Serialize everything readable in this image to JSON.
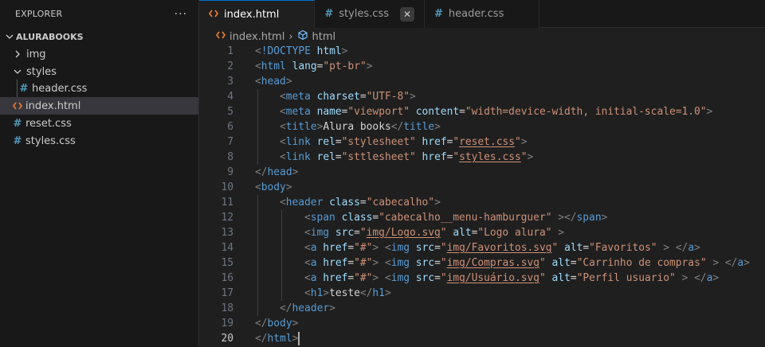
{
  "explorer": {
    "title": "EXPLORER",
    "more": "···",
    "root": "ALURABOOKS",
    "items": [
      {
        "label": "img",
        "type": "folder-collapsed",
        "depth": 1
      },
      {
        "label": "styles",
        "type": "folder-expanded",
        "depth": 1
      },
      {
        "label": "header.css",
        "type": "css",
        "depth": 2
      },
      {
        "label": "index.html",
        "type": "html",
        "depth": 1,
        "selected": true
      },
      {
        "label": "reset.css",
        "type": "css",
        "depth": 1
      },
      {
        "label": "styles.css",
        "type": "css",
        "depth": 1
      }
    ]
  },
  "tabs": [
    {
      "label": "index.html",
      "icon": "html-icon",
      "active": true
    },
    {
      "label": "styles.css",
      "icon": "css-icon",
      "active": false
    },
    {
      "label": "header.css",
      "icon": "css-icon",
      "active": false
    }
  ],
  "breadcrumb": {
    "file": "index.html",
    "separator": "›",
    "node": "html"
  },
  "code": {
    "current_line": 20,
    "lines": [
      {
        "n": 1,
        "indent": 0,
        "tokens": [
          [
            "t-punc",
            "<"
          ],
          [
            "t-tag",
            "!DOCTYPE"
          ],
          [
            "t-text",
            " "
          ],
          [
            "t-attr",
            "html"
          ],
          [
            "t-punc",
            ">"
          ]
        ]
      },
      {
        "n": 2,
        "indent": 0,
        "tokens": [
          [
            "t-punc",
            "<"
          ],
          [
            "t-tag",
            "html"
          ],
          [
            "t-text",
            " "
          ],
          [
            "t-attr",
            "lang"
          ],
          [
            "t-text",
            "="
          ],
          [
            "t-str",
            "\"pt-br\""
          ],
          [
            "t-punc",
            ">"
          ]
        ]
      },
      {
        "n": 3,
        "indent": 0,
        "tokens": [
          [
            "t-punc",
            "<"
          ],
          [
            "t-tag",
            "head"
          ],
          [
            "t-punc",
            ">"
          ]
        ]
      },
      {
        "n": 4,
        "indent": 1,
        "tokens": [
          [
            "t-punc",
            "<"
          ],
          [
            "t-tag",
            "meta"
          ],
          [
            "t-text",
            " "
          ],
          [
            "t-attr",
            "charset"
          ],
          [
            "t-text",
            "="
          ],
          [
            "t-str",
            "\"UTF-8\""
          ],
          [
            "t-punc",
            ">"
          ]
        ]
      },
      {
        "n": 5,
        "indent": 1,
        "tokens": [
          [
            "t-punc",
            "<"
          ],
          [
            "t-tag",
            "meta"
          ],
          [
            "t-text",
            " "
          ],
          [
            "t-attr",
            "name"
          ],
          [
            "t-text",
            "="
          ],
          [
            "t-str",
            "\"viewport\""
          ],
          [
            "t-text",
            " "
          ],
          [
            "t-attr",
            "content"
          ],
          [
            "t-text",
            "="
          ],
          [
            "t-str",
            "\"width=device-width, initial-scale=1.0\""
          ],
          [
            "t-punc",
            ">"
          ]
        ]
      },
      {
        "n": 6,
        "indent": 1,
        "tokens": [
          [
            "t-punc",
            "<"
          ],
          [
            "t-tag",
            "title"
          ],
          [
            "t-punc",
            ">"
          ],
          [
            "t-text",
            "Alura books"
          ],
          [
            "t-punc",
            "</"
          ],
          [
            "t-tag",
            "title"
          ],
          [
            "t-punc",
            ">"
          ]
        ]
      },
      {
        "n": 7,
        "indent": 1,
        "tokens": [
          [
            "t-punc",
            "<"
          ],
          [
            "t-tag",
            "link"
          ],
          [
            "t-text",
            " "
          ],
          [
            "t-attr",
            "rel"
          ],
          [
            "t-text",
            "="
          ],
          [
            "t-str",
            "\"stylesheet\""
          ],
          [
            "t-text",
            " "
          ],
          [
            "t-attr",
            "href"
          ],
          [
            "t-text",
            "="
          ],
          [
            "t-str",
            "\""
          ],
          [
            "t-str t-link",
            "reset.css"
          ],
          [
            "t-str",
            "\""
          ],
          [
            "t-punc",
            ">"
          ]
        ]
      },
      {
        "n": 8,
        "indent": 1,
        "tokens": [
          [
            "t-punc",
            "<"
          ],
          [
            "t-tag",
            "link"
          ],
          [
            "t-text",
            " "
          ],
          [
            "t-attr",
            "rel"
          ],
          [
            "t-text",
            "="
          ],
          [
            "t-str",
            "\"sttlesheet\""
          ],
          [
            "t-text",
            " "
          ],
          [
            "t-attr",
            "href"
          ],
          [
            "t-text",
            "="
          ],
          [
            "t-str",
            "\""
          ],
          [
            "t-str t-link",
            "styles.css"
          ],
          [
            "t-str",
            "\""
          ],
          [
            "t-punc",
            ">"
          ]
        ]
      },
      {
        "n": 9,
        "indent": 0,
        "tokens": [
          [
            "t-punc",
            "</"
          ],
          [
            "t-tag",
            "head"
          ],
          [
            "t-punc",
            ">"
          ]
        ]
      },
      {
        "n": 10,
        "indent": 0,
        "tokens": [
          [
            "t-punc",
            "<"
          ],
          [
            "t-tag",
            "body"
          ],
          [
            "t-punc",
            ">"
          ]
        ]
      },
      {
        "n": 11,
        "indent": 1,
        "tokens": [
          [
            "t-punc",
            "<"
          ],
          [
            "t-tag",
            "header"
          ],
          [
            "t-text",
            " "
          ],
          [
            "t-attr",
            "class"
          ],
          [
            "t-text",
            "="
          ],
          [
            "t-str",
            "\"cabecalho\""
          ],
          [
            "t-punc",
            ">"
          ]
        ]
      },
      {
        "n": 12,
        "indent": 2,
        "tokens": [
          [
            "t-punc",
            "<"
          ],
          [
            "t-tag",
            "span"
          ],
          [
            "t-text",
            " "
          ],
          [
            "t-attr",
            "class"
          ],
          [
            "t-text",
            "="
          ],
          [
            "t-str",
            "\"cabecalho__menu-hamburguer\""
          ],
          [
            "t-text",
            " "
          ],
          [
            "t-punc",
            "></"
          ],
          [
            "t-tag",
            "span"
          ],
          [
            "t-punc",
            ">"
          ]
        ]
      },
      {
        "n": 13,
        "indent": 2,
        "tokens": [
          [
            "t-punc",
            "<"
          ],
          [
            "t-tag",
            "img"
          ],
          [
            "t-text",
            " "
          ],
          [
            "t-attr",
            "src"
          ],
          [
            "t-text",
            "="
          ],
          [
            "t-str",
            "\""
          ],
          [
            "t-str t-link",
            "img/Logo.svg"
          ],
          [
            "t-str",
            "\""
          ],
          [
            "t-text",
            " "
          ],
          [
            "t-attr",
            "alt"
          ],
          [
            "t-text",
            "="
          ],
          [
            "t-str",
            "\"Logo alura\""
          ],
          [
            "t-text",
            " "
          ],
          [
            "t-punc",
            ">"
          ]
        ]
      },
      {
        "n": 14,
        "indent": 2,
        "tokens": [
          [
            "t-punc",
            "<"
          ],
          [
            "t-tag",
            "a"
          ],
          [
            "t-text",
            " "
          ],
          [
            "t-attr",
            "href"
          ],
          [
            "t-text",
            "="
          ],
          [
            "t-str",
            "\"#\""
          ],
          [
            "t-punc",
            ">"
          ],
          [
            "t-text",
            " "
          ],
          [
            "t-punc",
            "<"
          ],
          [
            "t-tag",
            "img"
          ],
          [
            "t-text",
            " "
          ],
          [
            "t-attr",
            "src"
          ],
          [
            "t-text",
            "="
          ],
          [
            "t-str",
            "\""
          ],
          [
            "t-str t-link",
            "img/Favoritos.svg"
          ],
          [
            "t-str",
            "\""
          ],
          [
            "t-text",
            " "
          ],
          [
            "t-attr",
            "alt"
          ],
          [
            "t-text",
            "="
          ],
          [
            "t-str",
            "\"Favoritos\""
          ],
          [
            "t-text",
            " "
          ],
          [
            "t-punc",
            "> </"
          ],
          [
            "t-tag",
            "a"
          ],
          [
            "t-punc",
            ">"
          ]
        ]
      },
      {
        "n": 15,
        "indent": 2,
        "tokens": [
          [
            "t-punc",
            "<"
          ],
          [
            "t-tag",
            "a"
          ],
          [
            "t-text",
            " "
          ],
          [
            "t-attr",
            "href"
          ],
          [
            "t-text",
            "="
          ],
          [
            "t-str",
            "\"#\""
          ],
          [
            "t-punc",
            ">"
          ],
          [
            "t-text",
            " "
          ],
          [
            "t-punc",
            "<"
          ],
          [
            "t-tag",
            "img"
          ],
          [
            "t-text",
            " "
          ],
          [
            "t-attr",
            "src"
          ],
          [
            "t-text",
            "="
          ],
          [
            "t-str",
            "\""
          ],
          [
            "t-str t-link",
            "img/Compras.svg"
          ],
          [
            "t-str",
            "\""
          ],
          [
            "t-text",
            " "
          ],
          [
            "t-attr",
            "alt"
          ],
          [
            "t-text",
            "="
          ],
          [
            "t-str",
            "\"Carrinho de compras\""
          ],
          [
            "t-text",
            " "
          ],
          [
            "t-punc",
            "> </"
          ],
          [
            "t-tag",
            "a"
          ],
          [
            "t-punc",
            ">"
          ]
        ]
      },
      {
        "n": 16,
        "indent": 2,
        "tokens": [
          [
            "t-punc",
            "<"
          ],
          [
            "t-tag",
            "a"
          ],
          [
            "t-text",
            " "
          ],
          [
            "t-attr",
            "href"
          ],
          [
            "t-text",
            "="
          ],
          [
            "t-str",
            "\"#\""
          ],
          [
            "t-punc",
            ">"
          ],
          [
            "t-text",
            " "
          ],
          [
            "t-punc",
            "<"
          ],
          [
            "t-tag",
            "img"
          ],
          [
            "t-text",
            " "
          ],
          [
            "t-attr",
            "src"
          ],
          [
            "t-text",
            "="
          ],
          [
            "t-str",
            "\""
          ],
          [
            "t-str t-link",
            "img/Usuário.svg"
          ],
          [
            "t-str",
            "\""
          ],
          [
            "t-text",
            " "
          ],
          [
            "t-attr",
            "alt"
          ],
          [
            "t-text",
            "="
          ],
          [
            "t-str",
            "\"Perfil usuario\""
          ],
          [
            "t-text",
            " "
          ],
          [
            "t-punc",
            "> </"
          ],
          [
            "t-tag",
            "a"
          ],
          [
            "t-punc",
            ">"
          ]
        ]
      },
      {
        "n": 17,
        "indent": 2,
        "tokens": [
          [
            "t-punc",
            "<"
          ],
          [
            "t-tag",
            "h1"
          ],
          [
            "t-punc",
            ">"
          ],
          [
            "t-text",
            "teste"
          ],
          [
            "t-punc",
            "</"
          ],
          [
            "t-tag",
            "h1"
          ],
          [
            "t-punc",
            ">"
          ]
        ]
      },
      {
        "n": 18,
        "indent": 1,
        "tokens": [
          [
            "t-punc",
            "</"
          ],
          [
            "t-tag",
            "header"
          ],
          [
            "t-punc",
            ">"
          ]
        ]
      },
      {
        "n": 19,
        "indent": 0,
        "tokens": [
          [
            "t-punc",
            "</"
          ],
          [
            "t-tag",
            "body"
          ],
          [
            "t-punc",
            ">"
          ]
        ]
      },
      {
        "n": 20,
        "indent": 0,
        "tokens": [
          [
            "t-punc",
            "</"
          ],
          [
            "t-tag",
            "html"
          ],
          [
            "t-punc",
            ">"
          ]
        ],
        "caret": true
      }
    ]
  }
}
